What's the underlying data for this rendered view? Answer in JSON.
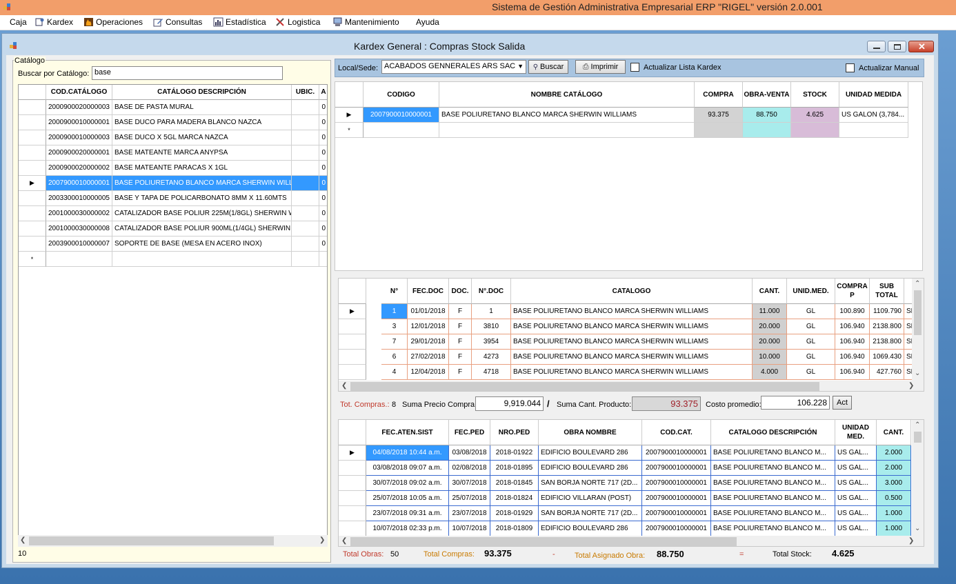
{
  "app_title": "Sistema de Gestión Administrativa Empresarial ERP  \"RIGEL\" versión 2.0.001",
  "menu": [
    "Caja",
    "Kardex",
    "Operaciones",
    "Consultas",
    "Estadística",
    "Logistica",
    "Mantenimiento",
    "Ayuda"
  ],
  "window_title": "Kardex General : Compras Stock Salida",
  "catalog": {
    "legend": "Catálogo",
    "search_label": "Buscar por Catálogo:",
    "search_value": "base",
    "headers": [
      "COD.CATÁLOGO",
      "CATÁLOGO DESCRIPCIÓN",
      "UBIC.",
      "A"
    ],
    "rows": [
      [
        "2000900020000003",
        "BASE DE PASTA MURAL",
        "",
        "0"
      ],
      [
        "2000900010000001",
        "BASE DUCO PARA MADERA BLANCO NAZCA",
        "",
        "0"
      ],
      [
        "2000900010000003",
        "BASE DUCO X 5GL MARCA NAZCA",
        "",
        "0"
      ],
      [
        "2000900020000001",
        "BASE MATEANTE MARCA ANYPSA",
        "",
        "0"
      ],
      [
        "2000900020000002",
        "BASE MATEANTE PARACAS X 1GL",
        "",
        "0"
      ],
      [
        "2007900010000001",
        "BASE POLIURETANO BLANCO MARCA SHERWIN WILLI...",
        "",
        "0"
      ],
      [
        "2003300010000005",
        "BASE Y TAPA DE POLICARBONATO 8MM X 11.60MTS",
        "",
        "0"
      ],
      [
        "2001000030000002",
        "CATALIZADOR BASE POLIUR 225M(1/8GL) SHERWIN W.",
        "",
        "0"
      ],
      [
        "2001000030000008",
        "CATALIZADOR BASE POLIUR 900ML(1/4GL) SHERWIN W.",
        "",
        "0"
      ],
      [
        "2003900010000007",
        "SOPORTE DE BASE (MESA EN ACERO INOX)",
        "",
        "0"
      ]
    ],
    "count": "10"
  },
  "toolbar": {
    "local_label": "Local/Sede:",
    "local_value": "ACABADOS GENNERALES ARS SAC",
    "buscar": "Buscar",
    "imprimir": "Imprimir",
    "actualizar_lista": "Actualizar Lista Kardex",
    "actualizar_manual": "Actualizar Manual"
  },
  "stock": {
    "headers": [
      "CODIGO",
      "NOMBRE CATÁLOGO",
      "COMPRA",
      "OBRA-VENTA",
      "STOCK",
      "UNIDAD MEDIDA"
    ],
    "row": [
      "2007900010000001",
      "BASE POLIURETANO BLANCO MARCA SHERWIN WILLIAMS",
      "93.375",
      "88.750",
      "4.625",
      "US GALON (3,784..."
    ]
  },
  "compras": {
    "headers": [
      "N°",
      "FEC.DOC",
      "DOC.",
      "N°.DOC",
      "CATALOGO",
      "CANT.",
      "UNID.MED.",
      "COMPRA P",
      "SUB TOTAL",
      ""
    ],
    "rows": [
      [
        "1",
        "01/01/2018",
        "F",
        "1",
        "BASE POLIURETANO BLANCO MARCA SHERWIN WILLIAMS",
        "11.000",
        "GL",
        "100.890",
        "1109.790",
        "SH"
      ],
      [
        "3",
        "12/01/2018",
        "F",
        "3810",
        "BASE POLIURETANO BLANCO MARCA SHERWIN WILLIAMS",
        "20.000",
        "GL",
        "106.940",
        "2138.800",
        "SH"
      ],
      [
        "7",
        "29/01/2018",
        "F",
        "3954",
        "BASE POLIURETANO BLANCO MARCA SHERWIN WILLIAMS",
        "20.000",
        "GL",
        "106.940",
        "2138.800",
        "SH"
      ],
      [
        "6",
        "27/02/2018",
        "F",
        "4273",
        "BASE POLIURETANO BLANCO MARCA SHERWIN WILLIAMS",
        "10.000",
        "GL",
        "106.940",
        "1069.430",
        "SH"
      ],
      [
        "4",
        "12/04/2018",
        "F",
        "4718",
        "BASE POLIURETANO BLANCO MARCA SHERWIN WILLIAMS",
        "4.000",
        "GL",
        "106.940",
        "427.760",
        "SH"
      ]
    ]
  },
  "summary": {
    "tot_compras_label": "Tot. Compras.:",
    "tot_compras": "8",
    "suma_precio_label": "Suma Precio Compra:",
    "suma_precio": "9,919.044",
    "slash": "/",
    "suma_cant_label": "Suma Cant. Producto:",
    "suma_cant": "93.375",
    "costo_label": "Costo promedio:",
    "costo": "106.228",
    "act": "Act"
  },
  "obras": {
    "headers": [
      "FEC.ATEN.SIST",
      "FEC.PED",
      "NRO.PED",
      "OBRA NOMBRE",
      "COD.CAT.",
      "CATALOGO DESCRIPCIÓN",
      "UNIDAD MED.",
      "CANT."
    ],
    "rows": [
      [
        "04/08/2018 10:44 a.m.",
        "03/08/2018",
        "2018-01922",
        "EDIFICIO BOULEVARD 286",
        "2007900010000001",
        "BASE POLIURETANO BLANCO M...",
        "US GAL...",
        "2.000"
      ],
      [
        "03/08/2018 09:07 a.m.",
        "02/08/2018",
        "2018-01895",
        "EDIFICIO BOULEVARD 286",
        "2007900010000001",
        "BASE POLIURETANO BLANCO M...",
        "US GAL...",
        "2.000"
      ],
      [
        "30/07/2018 09:02 a.m.",
        "30/07/2018",
        "2018-01845",
        "SAN BORJA NORTE 717 (2D...",
        "2007900010000001",
        "BASE POLIURETANO BLANCO M...",
        "US GAL...",
        "3.000"
      ],
      [
        "25/07/2018 10:05 a.m.",
        "25/07/2018",
        "2018-01824",
        "EDIFICIO VILLARAN (POST)",
        "2007900010000001",
        "BASE POLIURETANO BLANCO M...",
        "US GAL...",
        "0.500"
      ],
      [
        "23/07/2018 09:31 a.m.",
        "23/07/2018",
        "2018-01929",
        "SAN BORJA NORTE 717 (2D...",
        "2007900010000001",
        "BASE POLIURETANO BLANCO M...",
        "US GAL...",
        "1.000"
      ],
      [
        "10/07/2018 02:33 p.m.",
        "10/07/2018",
        "2018-01809",
        "EDIFICIO BOULEVARD 286",
        "2007900010000001",
        "BASE POLIURETANO BLANCO M...",
        "US GAL...",
        "1.000"
      ]
    ]
  },
  "footer": {
    "total_obras_label": "Total Obras:",
    "total_obras": "50",
    "total_compras_label": "Total Compras:",
    "total_compras": "93.375",
    "minus": "-",
    "total_asignado_label": "Total Asignado Obra:",
    "total_asignado": "88.750",
    "equals": "=",
    "total_stock_label": "Total Stock:",
    "total_stock": "4.625"
  },
  "colors": {
    "selected": "#3399ff",
    "compra_cell": "#d3d3d3",
    "obra_cell": "#a8ecec",
    "stock_cell": "#d8bcd8",
    "cant_cell": "#d0d0d0",
    "obras_cant": "#a8ecec",
    "accent_red": "#c0392b",
    "accent_orange": "#c87a00"
  }
}
